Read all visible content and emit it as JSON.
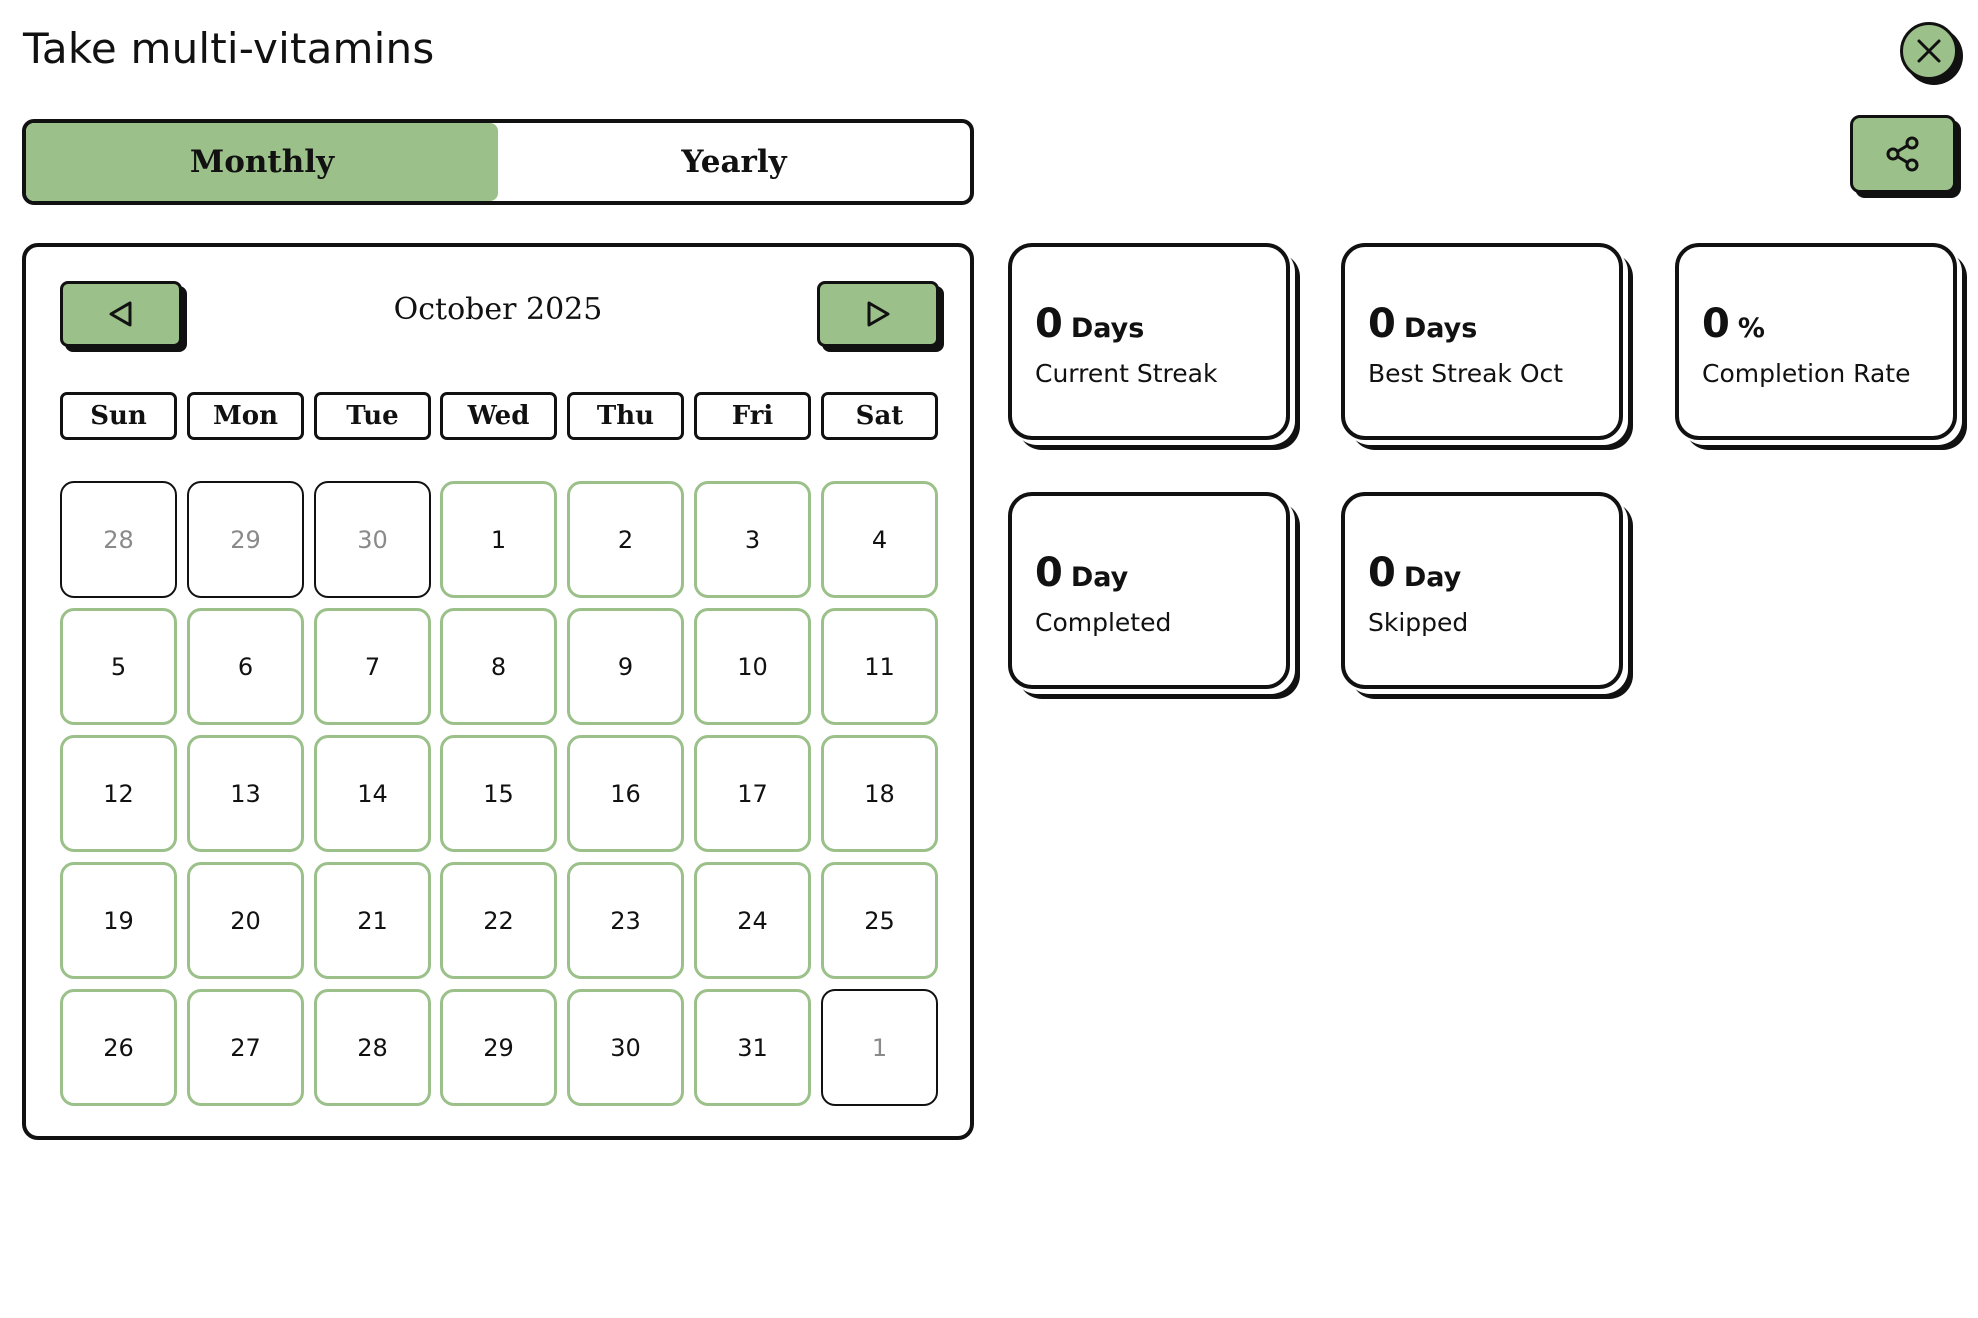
{
  "page": {
    "title": "Take multi-vitamins"
  },
  "view_toggle": {
    "monthly_label": "Monthly",
    "yearly_label": "Yearly",
    "active": "monthly"
  },
  "calendar": {
    "month_label": "October 2025",
    "weekdays": [
      "Sun",
      "Mon",
      "Tue",
      "Wed",
      "Thu",
      "Fri",
      "Sat"
    ],
    "days": [
      {
        "label": "28",
        "in_month": false
      },
      {
        "label": "29",
        "in_month": false
      },
      {
        "label": "30",
        "in_month": false
      },
      {
        "label": "1",
        "in_month": true
      },
      {
        "label": "2",
        "in_month": true
      },
      {
        "label": "3",
        "in_month": true
      },
      {
        "label": "4",
        "in_month": true
      },
      {
        "label": "5",
        "in_month": true
      },
      {
        "label": "6",
        "in_month": true
      },
      {
        "label": "7",
        "in_month": true
      },
      {
        "label": "8",
        "in_month": true
      },
      {
        "label": "9",
        "in_month": true
      },
      {
        "label": "10",
        "in_month": true
      },
      {
        "label": "11",
        "in_month": true
      },
      {
        "label": "12",
        "in_month": true
      },
      {
        "label": "13",
        "in_month": true
      },
      {
        "label": "14",
        "in_month": true
      },
      {
        "label": "15",
        "in_month": true
      },
      {
        "label": "16",
        "in_month": true
      },
      {
        "label": "17",
        "in_month": true
      },
      {
        "label": "18",
        "in_month": true
      },
      {
        "label": "19",
        "in_month": true
      },
      {
        "label": "20",
        "in_month": true
      },
      {
        "label": "21",
        "in_month": true
      },
      {
        "label": "22",
        "in_month": true
      },
      {
        "label": "23",
        "in_month": true
      },
      {
        "label": "24",
        "in_month": true
      },
      {
        "label": "25",
        "in_month": true
      },
      {
        "label": "26",
        "in_month": true
      },
      {
        "label": "27",
        "in_month": true
      },
      {
        "label": "28",
        "in_month": true
      },
      {
        "label": "29",
        "in_month": true
      },
      {
        "label": "30",
        "in_month": true
      },
      {
        "label": "31",
        "in_month": true
      },
      {
        "label": "1",
        "in_month": false
      }
    ]
  },
  "stats": [
    {
      "value": "0",
      "unit": "Days",
      "label": "Current Streak"
    },
    {
      "value": "0",
      "unit": "Days",
      "label": "Best Streak Oct"
    },
    {
      "value": "0",
      "unit": "%",
      "label": "Completion Rate"
    },
    {
      "value": "0",
      "unit": "Day",
      "label": "Completed"
    },
    {
      "value": "0",
      "unit": "Day",
      "label": "Skipped"
    }
  ],
  "icons": {
    "close": "close-icon",
    "share": "share-icon",
    "prev": "triangle-left-icon",
    "next": "triangle-right-icon"
  },
  "colors": {
    "accent": "#9bc089",
    "border": "#111111",
    "muted_text": "#8a8a8a"
  }
}
